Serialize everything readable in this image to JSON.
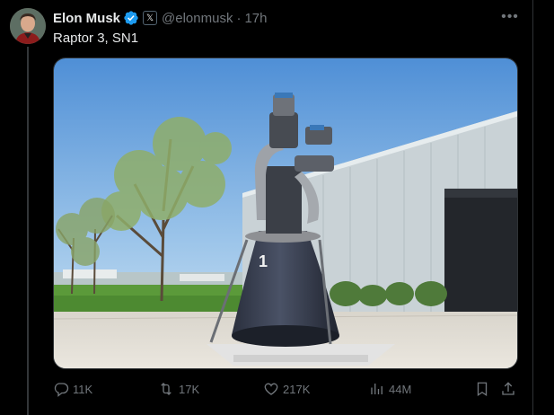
{
  "tweet": {
    "author_name": "Elon Musk",
    "affiliation_badge": "𝕏",
    "handle": "@elonmusk",
    "separator": "·",
    "time": "17h",
    "more_label": "•••",
    "text": "Raptor 3, SN1",
    "media_label": "1"
  },
  "actions": {
    "replies": "11K",
    "reposts": "17K",
    "likes": "217K",
    "views": "44M"
  },
  "icons": {
    "verified": "verified-badge-icon",
    "reply": "reply-icon",
    "repost": "repost-icon",
    "like": "heart-icon",
    "views": "views-chart-icon",
    "bookmark": "bookmark-icon",
    "share": "share-icon"
  },
  "colors": {
    "background": "#000000",
    "text": "#e7e9ea",
    "secondary": "#71767b",
    "verified": "#1d9bf0"
  }
}
